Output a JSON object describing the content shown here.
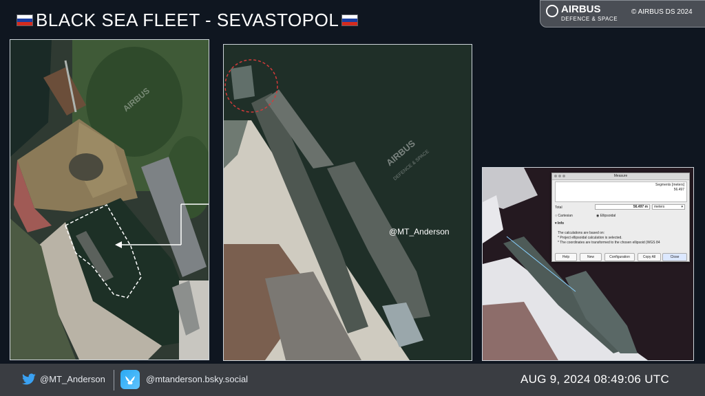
{
  "header": {
    "title": "BLACK SEA FLEET -  SEVASTOPOL",
    "flag_colors": [
      "#ffffff",
      "#1c3fa0",
      "#d52b1e"
    ]
  },
  "badge": {
    "brand": "AIRBUS",
    "subtitle": "DEFENCE & SPACE",
    "copyright": "© AIRBUS DS 2024"
  },
  "watermarks": {
    "brand": "AIRBUS",
    "subtitle": "DEFENCE & SPACE"
  },
  "annotation": {
    "handle": "@MT_Anderson"
  },
  "measure_dialog": {
    "title": "Measure",
    "segments_header": "Segments [meters]",
    "segment_value": "56.497",
    "total_label": "Total",
    "total_value": "56.497 m",
    "unit": "meters",
    "option_cartesian": "Cartesian",
    "option_ellipsoidal": "Ellipsoidal",
    "info_label": "Info",
    "info_line1": "The calculations are based on:",
    "info_line2": "* Project ellipsoidal calculation is selected.",
    "info_line3": "* The coordinates are transformed to the chosen ellipsoid (WGS 84",
    "buttons": [
      "Help",
      "New",
      "Configuration",
      "Copy All",
      "Close"
    ]
  },
  "footer": {
    "twitter_handle": "@MT_Anderson",
    "bluesky_handle": "@mtanderson.bsky.social",
    "timestamp": "AUG 9, 2024 08:49:06 UTC"
  },
  "colors": {
    "background": "#0f1620",
    "footer": "#3a3d42",
    "highlight_circle": "#d23a3a"
  }
}
